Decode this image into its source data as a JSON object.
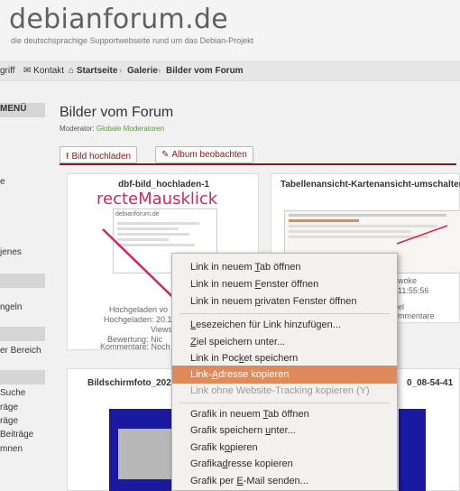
{
  "header": {
    "title": "debianforum.de",
    "subtitle": "die deutschsprachige Supportwebseite rund um das Debian-Projekt"
  },
  "navbar": {
    "cut_item": "griff",
    "contact": "Kontakt",
    "home": "Startseite",
    "gallery": "Galerie",
    "current": "Bilder vom Forum"
  },
  "sidebar": {
    "head1": "MENÜ",
    "t1": "e",
    "t2": "jenes",
    "t3": "ngeln",
    "t4": "er Bereich",
    "t5": "Suche",
    "t6": "räge",
    "t7": "räge",
    "t8": "Beiträge",
    "t9": "mnen"
  },
  "main": {
    "title": "Bilder vom Forum",
    "moderator_label": "Moderator:",
    "moderator_link": "Globale Moderatoren",
    "upload_label": "Bild hochladen",
    "watch_label": "Album beobachten"
  },
  "cards": [
    {
      "title": "dbf-bild_hochladen-1",
      "thumb_header": "debianforum.de",
      "meta1": "Hochgeladen vo",
      "meta2": "Hochgeladen: 20.1",
      "meta3": "Views",
      "meta4": "Bewertung: Nic",
      "meta5": "Kommentare: Noch k"
    },
    {
      "title": "Tabellenansicht-Kartenansicht-umschalter",
      "meta1": "woke",
      "meta2": "11:55:56",
      "meta3": "el",
      "meta4": "mmentare"
    },
    {
      "title": "Bildschirmfoto_2024"
    },
    {
      "title": "0_08-54-41"
    }
  ],
  "annotation": "recteMausklick",
  "context_menu": {
    "items": [
      {
        "pre": "Link in neuem ",
        "u": "T",
        "post": "ab öffnen"
      },
      {
        "pre": "Link in neuem ",
        "u": "F",
        "post": "enster öffnen"
      },
      {
        "pre": "Link in neuem ",
        "u": "p",
        "post": "rivaten Fenster öffnen"
      },
      {
        "pre": "",
        "u": "L",
        "post": "esezeichen für Link hinzufügen..."
      },
      {
        "pre": "",
        "u": "Z",
        "post": "iel speichern unter..."
      },
      {
        "pre": "Link in Poc",
        "u": "k",
        "post": "et speichern"
      },
      {
        "pre": "Link-",
        "u": "A",
        "post": "dresse kopieren"
      },
      {
        "pre": "Link ohne Website-Tracking kopieren (Y)",
        "u": "",
        "post": ""
      },
      {
        "pre": "Grafik in neuem ",
        "u": "T",
        "post": "ab öffnen"
      },
      {
        "pre": "Grafik speichern ",
        "u": "u",
        "post": "nter..."
      },
      {
        "pre": "Grafik k",
        "u": "o",
        "post": "pieren"
      },
      {
        "pre": "Grafika",
        "u": "d",
        "post": "resse kopieren"
      },
      {
        "pre": "Grafik per ",
        "u": "E",
        "post": "-Mail senden..."
      }
    ]
  },
  "colors": {
    "accent": "#8b1a1a",
    "highlight": "#e0895a",
    "annotation": "#d6245a"
  }
}
